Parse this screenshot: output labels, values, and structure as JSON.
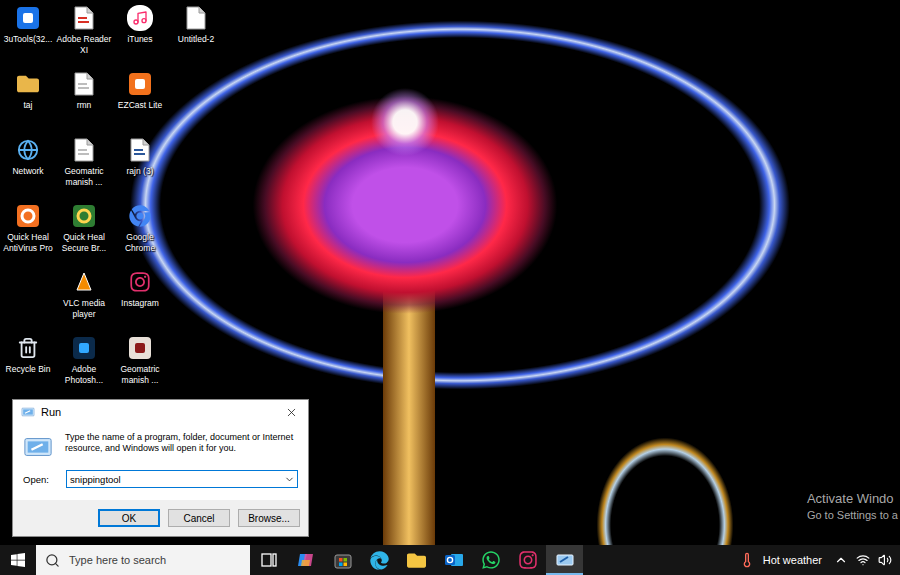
{
  "desktop": {
    "icons": [
      {
        "label": "3uTools(32..."
      },
      {
        "label": "Adobe Reader XI"
      },
      {
        "label": "iTunes"
      },
      {
        "label": "Untitled-2"
      },
      {
        "label": "taj"
      },
      {
        "label": "rmn"
      },
      {
        "label": "EZCast Lite"
      },
      {
        "label": "Network"
      },
      {
        "label": "Geomatric manish ..."
      },
      {
        "label": "rajn (3)"
      },
      {
        "label": "Quick Heal AntiVirus Pro"
      },
      {
        "label": "Quick Heal Secure Br..."
      },
      {
        "label": "Google Chrome"
      },
      {
        "label": "VLC media player"
      },
      {
        "label": "Instagram"
      },
      {
        "label": "Recycle Bin"
      },
      {
        "label": "Adobe Photosh..."
      },
      {
        "label": "Geomatric manish ..."
      }
    ]
  },
  "watermark": {
    "title": "Activate Windo",
    "subtitle": "Go to Settings to a"
  },
  "run_dialog": {
    "title": "Run",
    "description": "Type the name of a program, folder, document or Internet resource, and Windows will open it for you.",
    "open_label": "Open:",
    "input_value": "snippingtool",
    "buttons": [
      {
        "label": "OK",
        "focused": true
      },
      {
        "label": "Cancel",
        "focused": false
      },
      {
        "label": "Browse...",
        "focused": false
      }
    ]
  },
  "taskbar": {
    "search_placeholder": "Type here to search",
    "apps": [
      {
        "kind": "task-view",
        "active": false
      },
      {
        "kind": "copilot",
        "active": false
      },
      {
        "kind": "store",
        "active": false
      },
      {
        "kind": "edge",
        "active": false
      },
      {
        "kind": "explorer",
        "active": false
      },
      {
        "kind": "outlook",
        "active": false
      },
      {
        "kind": "whatsapp",
        "active": false
      },
      {
        "kind": "instagram",
        "active": false
      },
      {
        "kind": "run",
        "active": true
      }
    ],
    "weather": "Hot weather"
  }
}
